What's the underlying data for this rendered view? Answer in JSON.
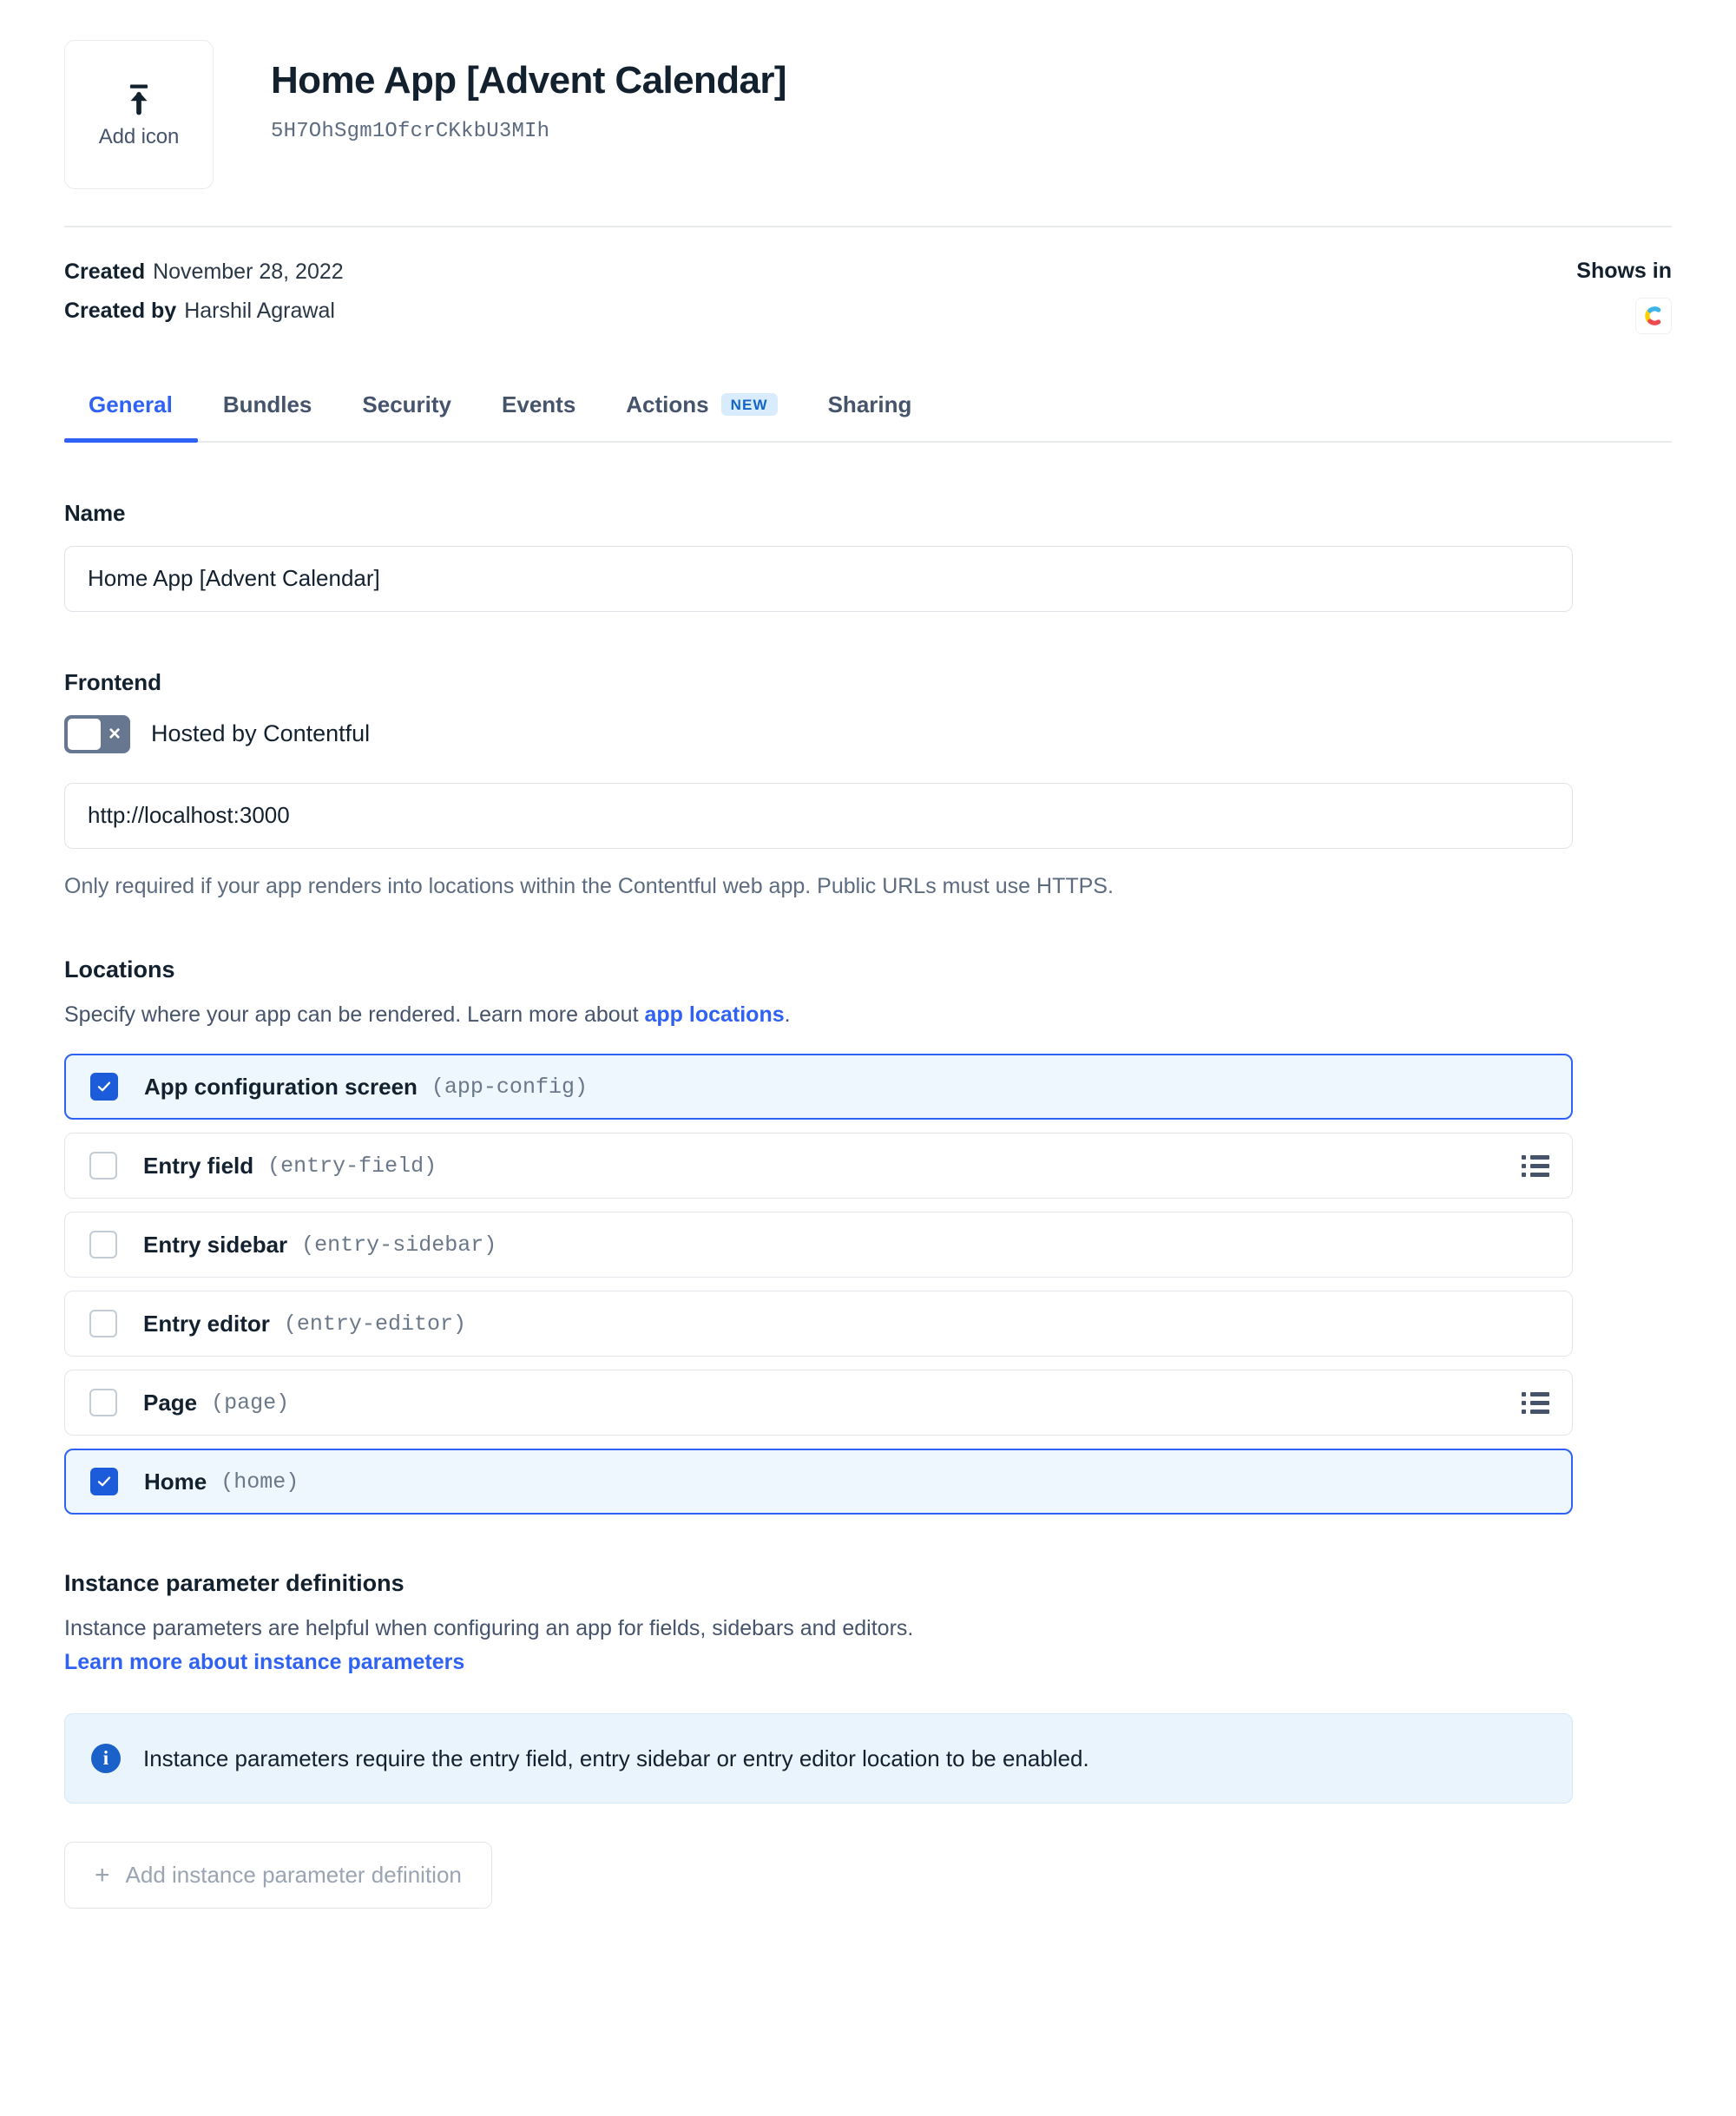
{
  "header": {
    "icon_upload_label": "Add icon",
    "title": "Home App [Advent Calendar]",
    "app_id": "5H7OhSgm1OfcrCKkbU3MIh"
  },
  "meta": {
    "created_key": "Created",
    "created_value": "November 28, 2022",
    "created_by_key": "Created by",
    "created_by_value": "Harshil Agrawal",
    "shows_in_label": "Shows in"
  },
  "tabs": [
    {
      "label": "General",
      "active": true,
      "badge": ""
    },
    {
      "label": "Bundles",
      "active": false,
      "badge": ""
    },
    {
      "label": "Security",
      "active": false,
      "badge": ""
    },
    {
      "label": "Events",
      "active": false,
      "badge": ""
    },
    {
      "label": "Actions",
      "active": false,
      "badge": "NEW"
    },
    {
      "label": "Sharing",
      "active": false,
      "badge": ""
    }
  ],
  "name_field": {
    "label": "Name",
    "value": "Home App [Advent Calendar]"
  },
  "frontend": {
    "label": "Frontend",
    "toggle_label": "Hosted by Contentful",
    "toggle_state": "off",
    "toggle_mark": "×",
    "url_value": "http://localhost:3000",
    "helper": "Only required if your app renders into locations within the Contentful web app. Public URLs must use HTTPS."
  },
  "locations": {
    "title": "Locations",
    "description_prefix": "Specify where your app can be rendered. Learn more about ",
    "description_link": "app locations",
    "description_suffix": ".",
    "items": [
      {
        "label": "App configuration screen",
        "slug": "(app-config)",
        "checked": true,
        "has_list_icon": false
      },
      {
        "label": "Entry field",
        "slug": "(entry-field)",
        "checked": false,
        "has_list_icon": true
      },
      {
        "label": "Entry sidebar",
        "slug": "(entry-sidebar)",
        "checked": false,
        "has_list_icon": false
      },
      {
        "label": "Entry editor",
        "slug": "(entry-editor)",
        "checked": false,
        "has_list_icon": false
      },
      {
        "label": "Page",
        "slug": "(page)",
        "checked": false,
        "has_list_icon": true
      },
      {
        "label": "Home",
        "slug": "(home)",
        "checked": true,
        "has_list_icon": false
      }
    ]
  },
  "instance_params": {
    "title": "Instance parameter definitions",
    "description": "Instance parameters are helpful when configuring an app for fields, sidebars and editors.",
    "learn_more_link": "Learn more about instance parameters",
    "notice": "Instance parameters require the entry field, entry sidebar or entry editor location to be enabled.",
    "add_button": "Add instance parameter definition",
    "add_button_plus": "+"
  },
  "colors": {
    "accent": "#2f62f4",
    "checkbox_checked": "#1c5cdb",
    "selected_bg": "#eef6fe",
    "notice_bg": "#eaf4fd",
    "badge_bg": "#d8ecfd",
    "badge_text": "#1566c4",
    "text_primary": "#13212f",
    "text_muted": "#5c6b80"
  }
}
